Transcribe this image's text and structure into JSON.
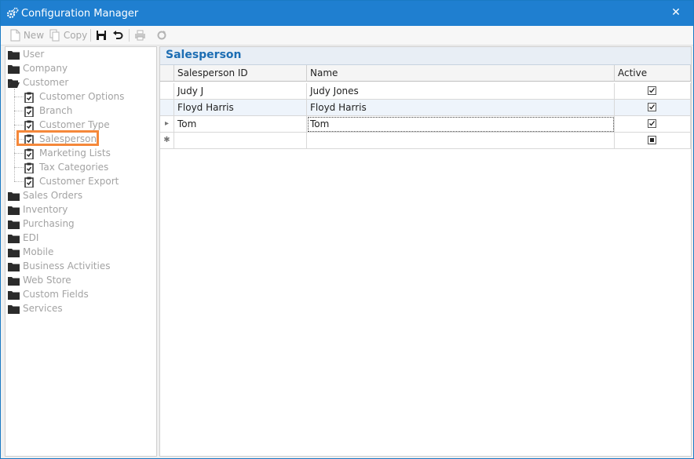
{
  "window": {
    "title": "Configuration Manager",
    "close_label": "✕"
  },
  "toolbar": {
    "new_label": "New",
    "copy_label": "Copy"
  },
  "tree": {
    "items": [
      {
        "label": "User",
        "icon": "folder-closed-icon",
        "level": 0
      },
      {
        "label": "Company",
        "icon": "folder-closed-icon",
        "level": 0
      },
      {
        "label": "Customer",
        "icon": "folder-open-icon",
        "level": 0
      },
      {
        "label": "Customer Options",
        "icon": "clipboard-icon",
        "level": 1
      },
      {
        "label": "Branch",
        "icon": "clipboard-icon",
        "level": 1
      },
      {
        "label": "Customer Type",
        "icon": "clipboard-icon",
        "level": 1
      },
      {
        "label": "Salesperson",
        "icon": "clipboard-icon",
        "level": 1,
        "selected": true
      },
      {
        "label": "Marketing Lists",
        "icon": "clipboard-icon",
        "level": 1
      },
      {
        "label": "Tax Categories",
        "icon": "clipboard-icon",
        "level": 1
      },
      {
        "label": "Customer Export",
        "icon": "clipboard-icon",
        "level": 1
      },
      {
        "label": "Sales Orders",
        "icon": "folder-closed-icon",
        "level": 0
      },
      {
        "label": "Inventory",
        "icon": "folder-closed-icon",
        "level": 0
      },
      {
        "label": "Purchasing",
        "icon": "folder-closed-icon",
        "level": 0
      },
      {
        "label": "EDI",
        "icon": "folder-closed-icon",
        "level": 0
      },
      {
        "label": "Mobile",
        "icon": "folder-closed-icon",
        "level": 0
      },
      {
        "label": "Business Activities",
        "icon": "folder-closed-icon",
        "level": 0
      },
      {
        "label": "Web Store",
        "icon": "folder-closed-icon",
        "level": 0
      },
      {
        "label": "Custom Fields",
        "icon": "folder-closed-icon",
        "level": 0
      },
      {
        "label": "Services",
        "icon": "folder-closed-icon",
        "level": 0
      }
    ]
  },
  "panel": {
    "title": "Salesperson",
    "columns": [
      "Salesperson ID",
      "Name",
      "Active"
    ],
    "rows": [
      {
        "id": "Judy J",
        "name": "Judy Jones",
        "active": true
      },
      {
        "id": "Floyd Harris",
        "name": "Floyd Harris",
        "active": true
      },
      {
        "id": "Tom",
        "name": "Tom",
        "active": true
      }
    ],
    "current_row_marker": "▸",
    "new_row_marker": "✱"
  },
  "colors": {
    "titlebar": "#1f7fd0",
    "accent_title": "#1c6db3",
    "selection_outline": "#f5883a"
  }
}
